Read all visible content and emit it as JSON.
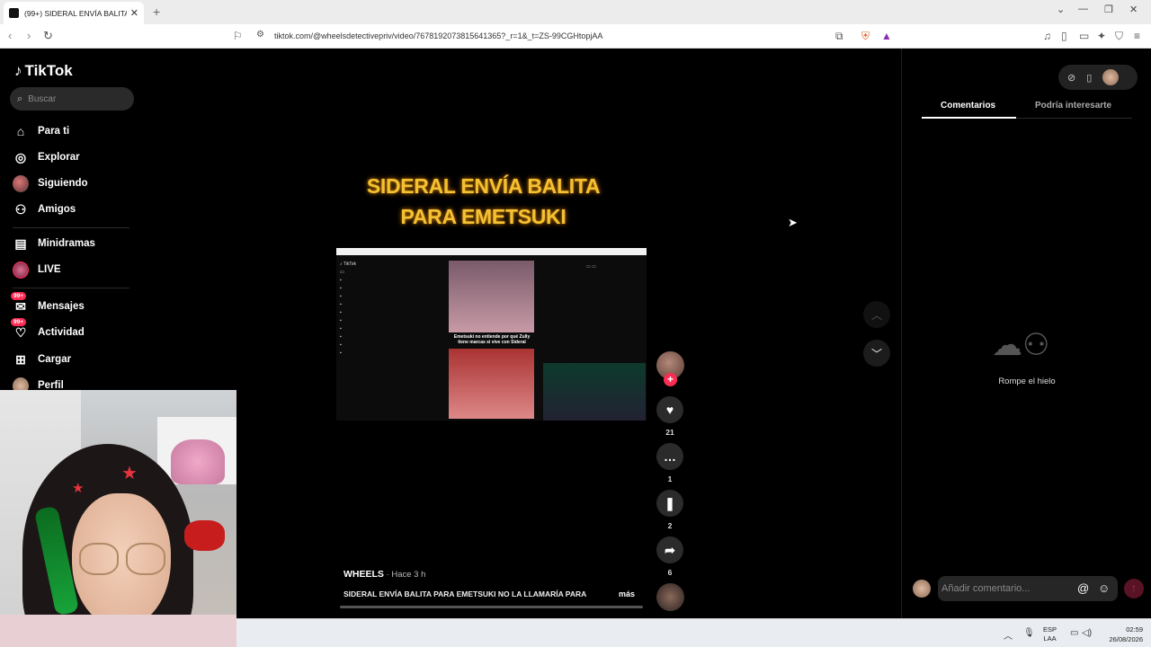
{
  "browser": {
    "tab_title": "(99+) SIDERAL ENVÍA BALITA PARA",
    "tab_close": "✕",
    "new_tab": "+",
    "url": "tiktok.com/@wheelsdetectivepriv/video/7678192073815641365?_r=1&_t=ZS-99CGHtopjAA",
    "win_min": "—",
    "win_max": "❐",
    "win_close": "✕",
    "win_down": "⌄"
  },
  "tiktok": {
    "logo": "TikTok",
    "search_placeholder": "Buscar",
    "nav": [
      {
        "label": "Para ti",
        "icon": "⌂"
      },
      {
        "label": "Explorar",
        "icon": "◎"
      },
      {
        "label": "Siguiendo",
        "icon": ""
      },
      {
        "label": "Amigos",
        "icon": "⚇"
      },
      {
        "label": "Minidramas",
        "icon": "▤"
      },
      {
        "label": "LIVE",
        "icon": ""
      },
      {
        "label": "Mensajes",
        "icon": "✉",
        "badge": "99+"
      },
      {
        "label": "Actividad",
        "icon": "♡",
        "badge": "99+"
      },
      {
        "label": "Cargar",
        "icon": "⊞"
      },
      {
        "label": "Perfil",
        "icon": ""
      }
    ]
  },
  "video": {
    "title_line1": "SIDERAL ENVÍA BALITA",
    "title_line2": "PARA EMETSUKI",
    "inner_caption": "Emetsuki no entiende por qué Zully tiene marcas si vive con Sideral",
    "author": "WHEELS",
    "time": " · Hace 3 h",
    "description": "SIDERAL ENVÍA BALITA PARA EMETSUKI NO LA LLAMARÍA PARA",
    "more": "más",
    "likes": "21",
    "comments": "1",
    "saves": "2",
    "shares": "6"
  },
  "panel": {
    "tab_comments": "Comentarios",
    "tab_interest": "Podría interesarte",
    "empty_text": "Rompe el hielo",
    "comment_placeholder": "Añadir comentario...",
    "at_symbol": "@",
    "emoji_symbol": "☺",
    "send_symbol": "↑"
  },
  "taskbar": {
    "lang_line1": "ESP",
    "lang_line2": "LAA",
    "time": "02:59",
    "date": "26/08/2026"
  }
}
